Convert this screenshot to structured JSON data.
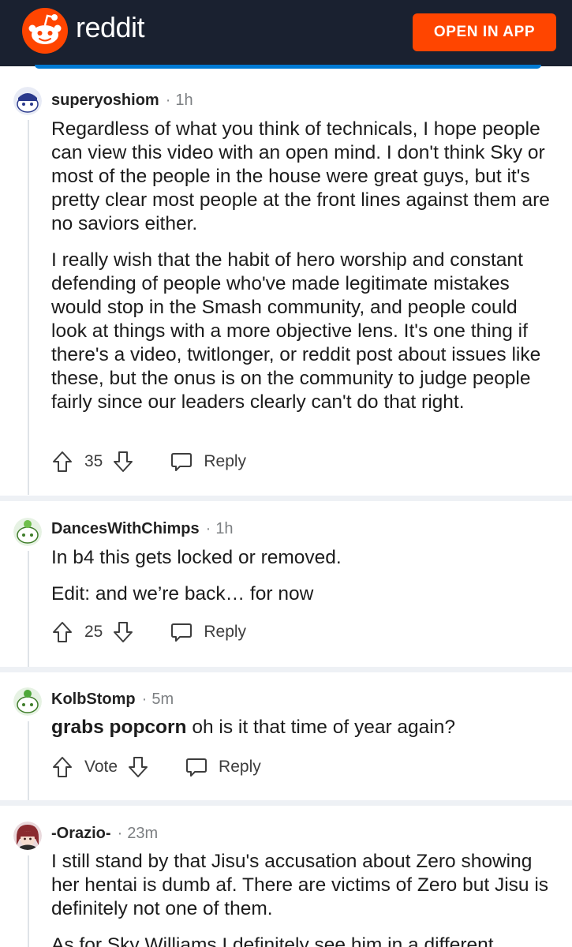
{
  "header": {
    "brand": "reddit",
    "open_app_label": "OPEN IN APP",
    "brand_color": "#ff4500",
    "bg_color": "#1a2130"
  },
  "comments": [
    {
      "username": "superyoshiom",
      "time": "1h",
      "paragraphs": [
        "Regardless of what you think of technicals, I hope people can view this video with an open mind. I don't think Sky or most of the people in the house were great guys, but it's pretty clear most people at the front lines against them are no saviors either.",
        "I really wish that the habit of hero worship and constant defending of people who've made legitimate mistakes would stop in the Smash community, and people could look at things with a more objective lens. It's one thing if there's a video, twitlonger, or reddit post about issues like these, but the onus is on the community to judge people fairly since our leaders clearly can't do that right."
      ],
      "score": "35",
      "reply_label": "Reply",
      "avatar_icon": "snoo-blue-avatar-icon"
    },
    {
      "username": "DancesWithChimps",
      "time": "1h",
      "paragraphs": [
        "In b4 this gets locked or removed.",
        "Edit: and we’re back… for now"
      ],
      "score": "25",
      "reply_label": "Reply",
      "avatar_icon": "snoo-green-avatar-icon"
    },
    {
      "username": "KolbStomp",
      "time": "5m",
      "bold_lead": "grabs popcorn",
      "text": " oh is it that time of year again?",
      "score": "Vote",
      "reply_label": "Reply",
      "avatar_icon": "snoo-green-avatar-icon"
    },
    {
      "username": "-Orazio-",
      "time": "23m",
      "paragraphs": [
        "I still stand by that Jisu's accusation about Zero showing her hentai is dumb af. There are victims of Zero but Jisu is definitely not one of them.",
        "As for Sky Williams I definitely see him in a different"
      ],
      "avatar_icon": "anime-avatar-icon"
    }
  ]
}
